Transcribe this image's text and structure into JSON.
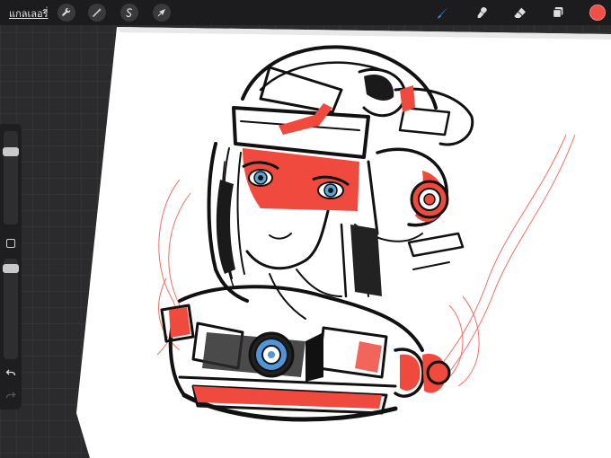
{
  "toolbar": {
    "gallery_label": "แกลเลอรี่",
    "left_tools": [
      {
        "name": "actions",
        "icon": "wrench-icon"
      },
      {
        "name": "adjustments",
        "icon": "magic-wand-icon"
      },
      {
        "name": "selection",
        "icon": "selection-s-icon"
      },
      {
        "name": "transform",
        "icon": "arrow-cursor-icon"
      }
    ],
    "right_tools": [
      {
        "name": "brush",
        "icon": "brush-icon",
        "active": true
      },
      {
        "name": "smudge",
        "icon": "smudge-icon"
      },
      {
        "name": "eraser",
        "icon": "eraser-icon"
      },
      {
        "name": "layers",
        "icon": "layers-icon"
      }
    ],
    "current_color": "#ef4f45",
    "active_tool_color": "#2f8ff0"
  },
  "sidebar": {
    "brush_size_level": 0.1,
    "opacity_level": 0.95
  },
  "colors": {
    "sketch_red": "#f04a3e",
    "lens_blue": "#4f95d8",
    "ink": "#111111",
    "background": "#2b2b2d"
  }
}
